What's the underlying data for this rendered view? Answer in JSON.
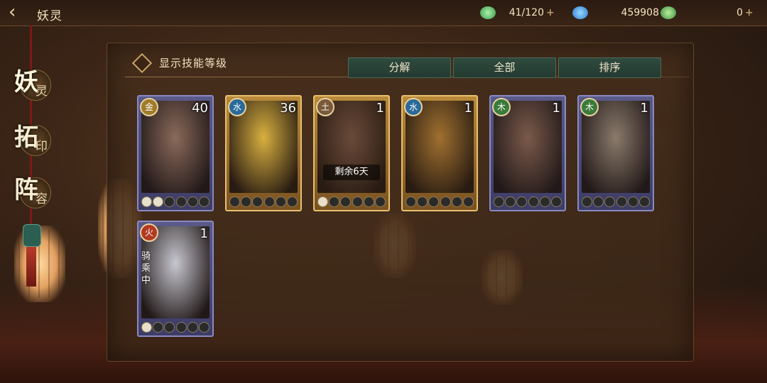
{
  "header": {
    "title": "妖灵",
    "resources": [
      {
        "name": "jade-stamina",
        "value": "41/120",
        "color": "#6fcf7a"
      },
      {
        "name": "spirit-gourd",
        "value": "459908",
        "color": "#3fa0ef"
      },
      {
        "name": "green-coin",
        "value": "0",
        "color": "#4fbf5a"
      }
    ]
  },
  "sidebar": {
    "items": [
      {
        "big": "妖",
        "small": "灵",
        "active": true
      },
      {
        "big": "拓",
        "small": "印",
        "active": false
      },
      {
        "big": "阵",
        "small": "容",
        "active": false
      }
    ]
  },
  "toolbar": {
    "skill_toggle_label": "显示技能等级",
    "tabs": [
      "分解",
      "全部",
      "排序"
    ]
  },
  "cards": [
    {
      "element": "金",
      "level": "40",
      "frame": "purple",
      "art_color": "#8a6a5a",
      "pips_on": 2
    },
    {
      "element": "水",
      "level": "36",
      "frame": "gold",
      "art_color": "#d8b040",
      "pips_on": 0
    },
    {
      "element": "土",
      "level": "1",
      "frame": "gold",
      "art_color": "#6a4a3a",
      "pips_on": 1,
      "timer": "剩余6天"
    },
    {
      "element": "水",
      "level": "1",
      "frame": "gold",
      "art_color": "#a07030",
      "pips_on": 0
    },
    {
      "element": "木",
      "level": "1",
      "frame": "purple",
      "art_color": "#7a5a4a",
      "pips_on": 0
    },
    {
      "element": "木",
      "level": "1",
      "frame": "purple",
      "art_color": "#8a7a6a",
      "pips_on": 0
    },
    {
      "element": "火",
      "level": "1",
      "frame": "purple",
      "art_color": "#c8c8d0",
      "pips_on": 1,
      "riding": "骑乘中"
    }
  ]
}
